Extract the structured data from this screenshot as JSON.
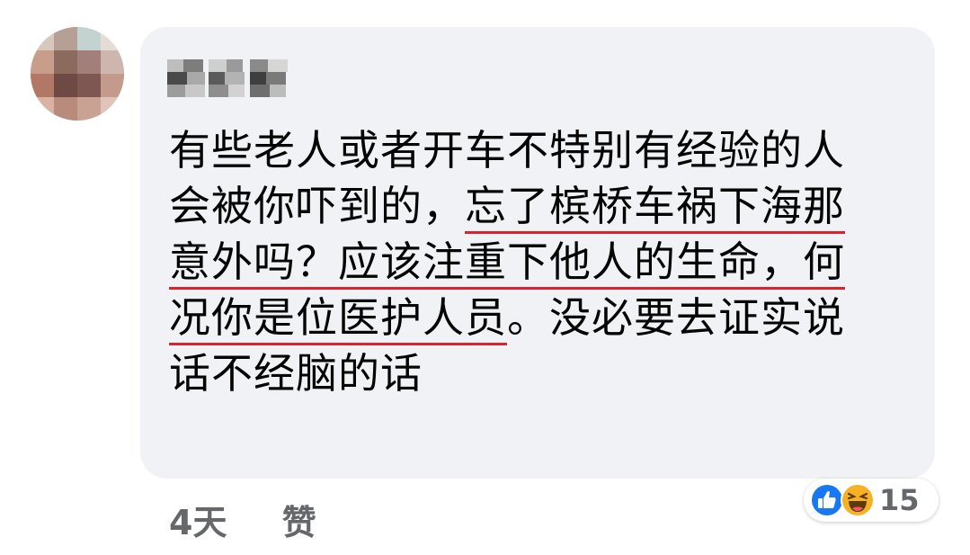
{
  "comment": {
    "author_name": "",
    "lines": [
      {
        "plain": "有些老人或者开车不特别有经验的人",
        "underlined": ""
      },
      {
        "plain": "会被你吓到的，",
        "underlined": "忘了槟桥车祸下海那"
      },
      {
        "plain": "",
        "underlined": "意外吗？应该注重下他人的生命，何"
      },
      {
        "plain_after": "。没必要去证实说",
        "underlined": "况你是位医护人员"
      },
      {
        "plain": "话不经脑的话",
        "underlined": ""
      }
    ]
  },
  "meta": {
    "time": "4天",
    "like_label": "赞"
  },
  "reactions": {
    "icons": [
      "like-icon",
      "haha-icon"
    ],
    "count": "15"
  },
  "colors": {
    "bubble": "#f0f2f5",
    "text": "#050505",
    "meta": "#65676b",
    "underline": "#e0202a",
    "like_blue": "#1877f2",
    "haha_yellow": "#f7b125"
  }
}
